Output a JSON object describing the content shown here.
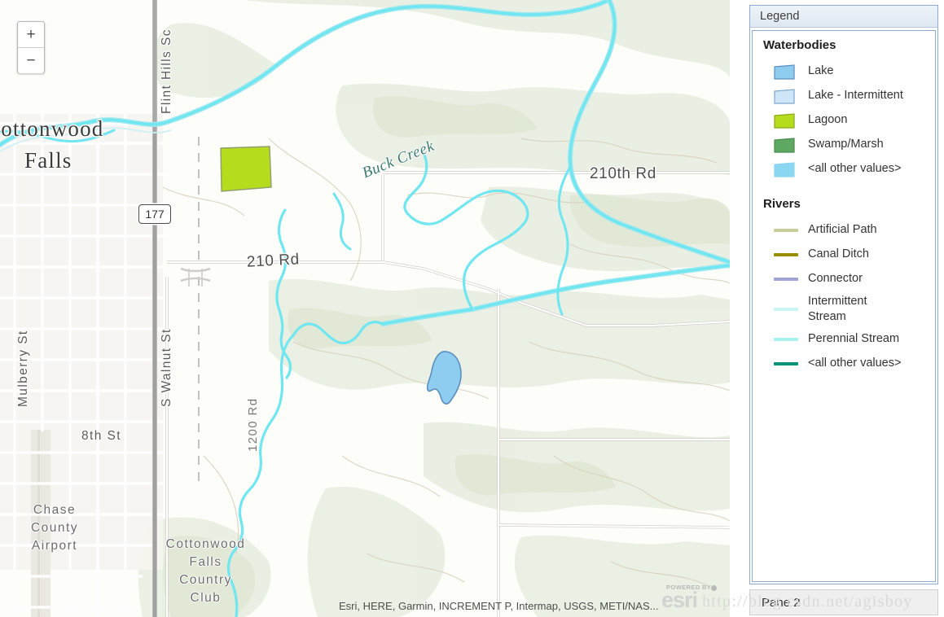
{
  "map": {
    "zoom_in_label": "+",
    "zoom_out_label": "−",
    "attribution": "Esri, HERE, Garmin, INCREMENT P, Intermap, USGS, METI/NAS...",
    "esri_powered_by": "POWERED BY",
    "esri_wordmark": "esri",
    "highway_shield": "177",
    "labels": {
      "city": "Cottonwood\nFalls",
      "city_line1": "Cottonwood",
      "city_line2": "Falls",
      "street_mulberry": "Mulberry St",
      "street_s_walnut": "S Walnut St",
      "street_flint_hills": "Flint Hills Sc",
      "street_8th": "8th St",
      "road_210": "210 Rd",
      "road_210th": "210th Rd",
      "road_1200": "1200 Rd",
      "creek": "Buck Creek",
      "poi_airport": "Chase\nCounty\nAirport",
      "poi_airport_line1": "Chase",
      "poi_airport_line2": "County",
      "poi_airport_line3": "Airport",
      "poi_country_club_line1": "Cottonwood",
      "poi_country_club_line2": "Falls",
      "poi_country_club_line3": "Country",
      "poi_country_club_line4": "Club"
    }
  },
  "legend": {
    "title": "Legend",
    "groups": [
      {
        "title": "Waterbodies",
        "symbol_type": "polygon",
        "items": [
          {
            "label": "Lake",
            "fill": "#8ecdef",
            "stroke": "#5b8fbf"
          },
          {
            "label": "Lake - Intermittent",
            "fill": "#cfe6f8",
            "stroke": "#7ea8cd"
          },
          {
            "label": "Lagoon",
            "fill": "#b5dd1e",
            "stroke": "#8aa817"
          },
          {
            "label": "Swamp/Marsh",
            "fill": "#5fa862",
            "stroke": "#4a8b4d"
          },
          {
            "label": "<all other values>",
            "fill": "#8bd6f0",
            "stroke": "#8bd6f0"
          }
        ]
      },
      {
        "title": "Rivers",
        "symbol_type": "line",
        "items": [
          {
            "label": "Artificial Path",
            "color": "#c8cf9c"
          },
          {
            "label": "Canal Ditch",
            "color": "#9a8e00"
          },
          {
            "label": "Connector",
            "color": "#9fa4d4"
          },
          {
            "label": "Intermittent Stream",
            "color": "#c9f6f4"
          },
          {
            "label": "Perennial Stream",
            "color": "#a5f2f0"
          },
          {
            "label": "<all other values>",
            "color": "#009179"
          }
        ]
      }
    ]
  },
  "status_bar": {
    "pane_label": "Pane 2"
  },
  "watermark": {
    "text": "http://blog.csdn.net/agisboy"
  },
  "colors": {
    "panel_border": "#8cabcf",
    "panel_header_bg": "#e4ecf5",
    "map_land": "#fdfdfa",
    "map_forest": "#e7ede0",
    "stream_cyan": "#6fe6f0"
  }
}
